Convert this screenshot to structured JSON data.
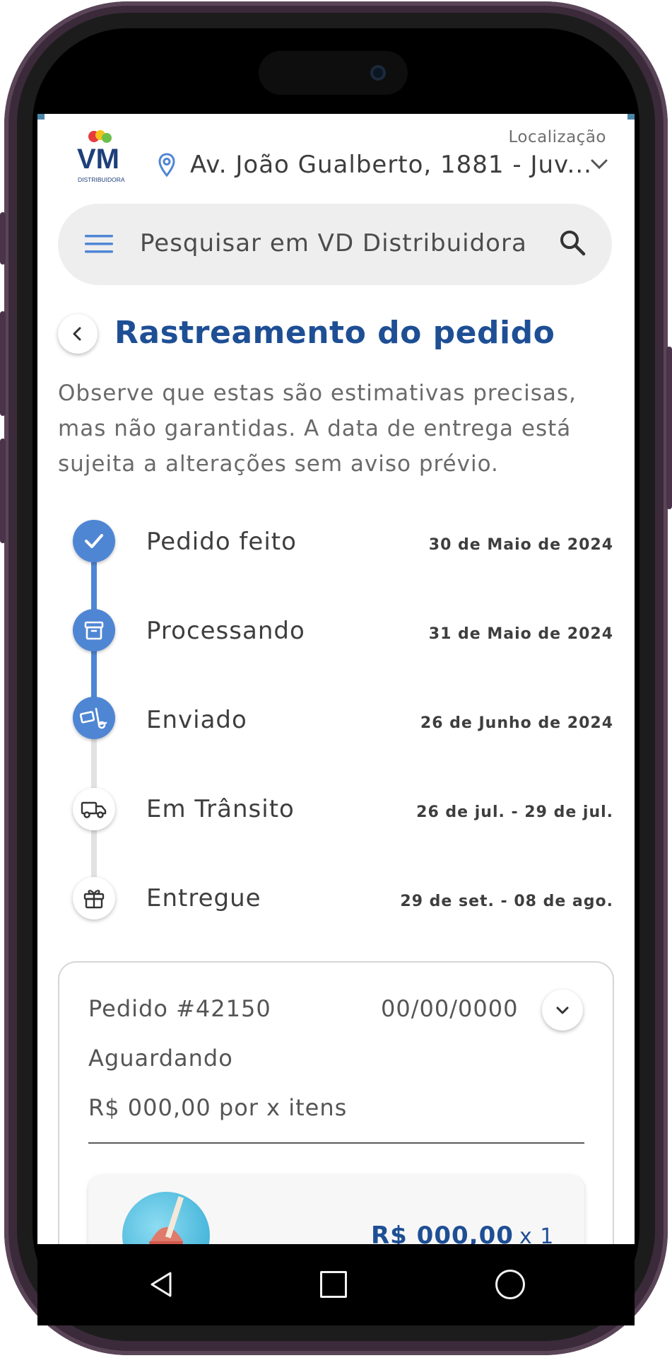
{
  "header": {
    "brand_initials": "VM",
    "brand_sub": "DISTRIBUIDORA",
    "location_label": "Localização",
    "address": "Av. João Gualberto, 1881 - Juv...",
    "icons": [
      "location-pin-icon",
      "chevron-down-icon"
    ]
  },
  "search": {
    "placeholder": "Pesquisar em VD Distribuidora",
    "icons": [
      "menu-icon",
      "search-icon"
    ]
  },
  "page": {
    "title": "Rastreamento do pedido",
    "notice": "Observe que estas são estimativas precisas, mas não garantidas. A data de entrega está sujeita a alterações sem aviso prévio."
  },
  "timeline": {
    "steps": [
      {
        "label": "Pedido feito",
        "date": "30 de Maio de 2024",
        "status": "done",
        "icon": "check-icon"
      },
      {
        "label": "Processando",
        "date": "31 de Maio de 2024",
        "status": "done",
        "icon": "box-icon"
      },
      {
        "label": "Enviado",
        "date": "26 de Junho de 2024",
        "status": "done",
        "icon": "dolly-icon"
      },
      {
        "label": "Em Trânsito",
        "date": "26 de jul. -  29 de jul.",
        "status": "pending",
        "icon": "truck-icon"
      },
      {
        "label": "Entregue",
        "date": "29 de set. -  08 de ago.",
        "status": "pending",
        "icon": "gift-icon"
      }
    ],
    "colors": {
      "done": "#4f86d4",
      "pending_line": "#e2e2e2"
    }
  },
  "order": {
    "id": "Pedido #42150",
    "date": "00/00/0000",
    "status": "Aguardando",
    "total": "R$ 000,00 por x itens",
    "item": {
      "price": "R$ 000,00",
      "qty": "x 1"
    }
  },
  "colors": {
    "accent": "#1e4f95",
    "step_done": "#4f86d4"
  }
}
